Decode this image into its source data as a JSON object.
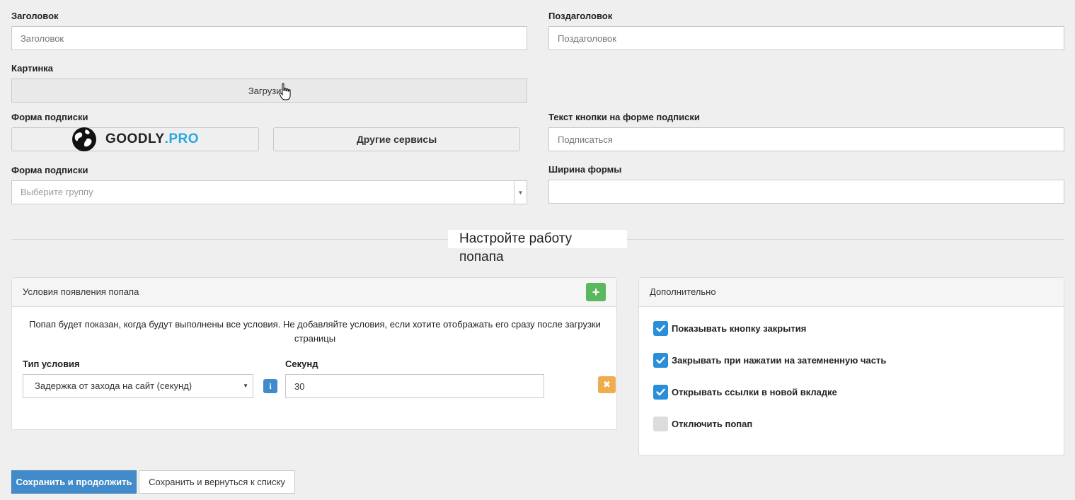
{
  "form": {
    "title_label": "Заголовок",
    "title_placeholder": "Заголовок",
    "subtitle_label": "Поздаголовок",
    "subtitle_placeholder": "Поздаголовок",
    "image_label": "Картинка",
    "upload_label": "Загрузить",
    "subscribe_form_label": "Форма подписки",
    "goodly_logo_text": "GOODLY",
    "goodly_logo_suffix": ".PRO",
    "other_services_label": "Другие сервисы",
    "button_text_label": "Текст кнопки на форме подписки",
    "button_text_placeholder": "Подписаться",
    "group_label": "Форма подписки",
    "group_placeholder": "Выберите группу",
    "width_label": "Ширина формы",
    "width_value": ""
  },
  "section": {
    "title": "Настройте работу попапа"
  },
  "conditions": {
    "header": "Условия появления попапа",
    "add_icon": "plus-icon",
    "info_text": "Попап будет показан, когда будут выполнены все условия. Не добавляйте условия, если хотите отображать его сразу после загрузки страницы",
    "type_label": "Тип условия",
    "type_value": "Задержка от захода на сайт (секунд)",
    "seconds_label": "Секунд",
    "seconds_value": "30"
  },
  "extra": {
    "header": "Дополнительно",
    "options": [
      {
        "label": "Показывать кнопку закрытия",
        "checked": true
      },
      {
        "label": "Закрывать при нажатии на затемненную часть",
        "checked": true
      },
      {
        "label": "Открывать ссылки в новой вкладке",
        "checked": true
      },
      {
        "label": "Отключить попап",
        "checked": false
      }
    ]
  },
  "actions": {
    "save_continue": "Сохранить и продолжить",
    "save_return": "Сохранить и вернуться к списку"
  },
  "colors": {
    "primary": "#428bca",
    "success": "#5cb85c",
    "warning": "#f0ad4e",
    "checkbox": "#2a8fd8",
    "logo_accent": "#29a8e0"
  }
}
